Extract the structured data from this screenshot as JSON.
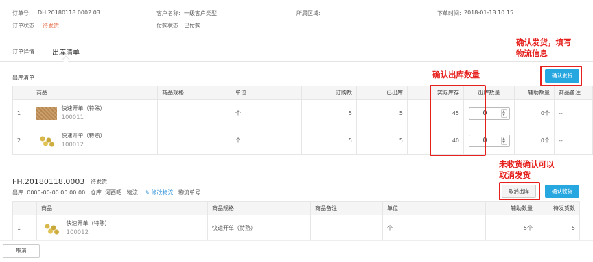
{
  "order_header": {
    "order_no_label": "订单号:",
    "order_no": "DH.20180118.0002.03",
    "customer_label": "客户名称:",
    "customer": "一级客户类型",
    "region_label": "所属区域:",
    "region": "",
    "time_label": "下单时间:",
    "time": "2018-01-18 10:15",
    "status_label": "订单状态:",
    "status": "待发货",
    "pay_label": "付款状态:",
    "pay": "已付款"
  },
  "tabs": [
    {
      "label": "订单详情"
    },
    {
      "label": "出库清单"
    }
  ],
  "outbound": {
    "title": "出库清单",
    "confirm_ship_label": "确认发货",
    "columns": [
      "商品",
      "商品规格",
      "单位",
      "订购数",
      "已出库",
      "实际库存",
      "出库数量",
      "辅助数量",
      "商品备注"
    ],
    "rows": [
      {
        "index": "1",
        "name": "快速开单（特殊）",
        "code": "100011",
        "spec": "",
        "unit": "个",
        "ordered": "5",
        "shipped": "5",
        "stock": "45",
        "qty": "0",
        "aux": "0个",
        "remark": "--"
      },
      {
        "index": "2",
        "name": "快速开单（特熟）",
        "code": "100012",
        "spec": "",
        "unit": "个",
        "ordered": "5",
        "shipped": "5",
        "stock": "40",
        "qty": "0",
        "aux": "0个",
        "remark": "--"
      }
    ]
  },
  "shipment": {
    "no": "FH.20180118.0003",
    "status": "待发货",
    "out_label": "出库:",
    "out_time": "0000-00-00 00:00:00",
    "warehouse_label": "仓库:",
    "warehouse": "河西吧",
    "logistics_label": "物流:",
    "edit_logistics": "修改物流",
    "tracking_label": "物流单号:",
    "cancel_out_label": "取消出库",
    "confirm_receive_label": "确认收货",
    "columns": [
      "商品",
      "商品规格",
      "商品备注",
      "单位",
      "辅助数量",
      "待发货数"
    ],
    "rows": [
      {
        "index": "1",
        "name": "快速开单（特熟）",
        "code": "100012",
        "spec": "快速开单（特熟）",
        "remark": "",
        "unit": "个",
        "aux": "5个",
        "pending": "5"
      }
    ]
  },
  "footer": {
    "cancel_label": "取消"
  },
  "annotations": {
    "confirm_ship": [
      "确认发货，填写",
      "物流信息"
    ],
    "confirm_qty": "确认出库数量",
    "cancel": [
      "未收货确认可以",
      "取消发货"
    ],
    "color": "#e6201c"
  },
  "colors": {
    "accent": "#27a7e0",
    "status": "#e8704e",
    "link": "#2a8fd8"
  }
}
